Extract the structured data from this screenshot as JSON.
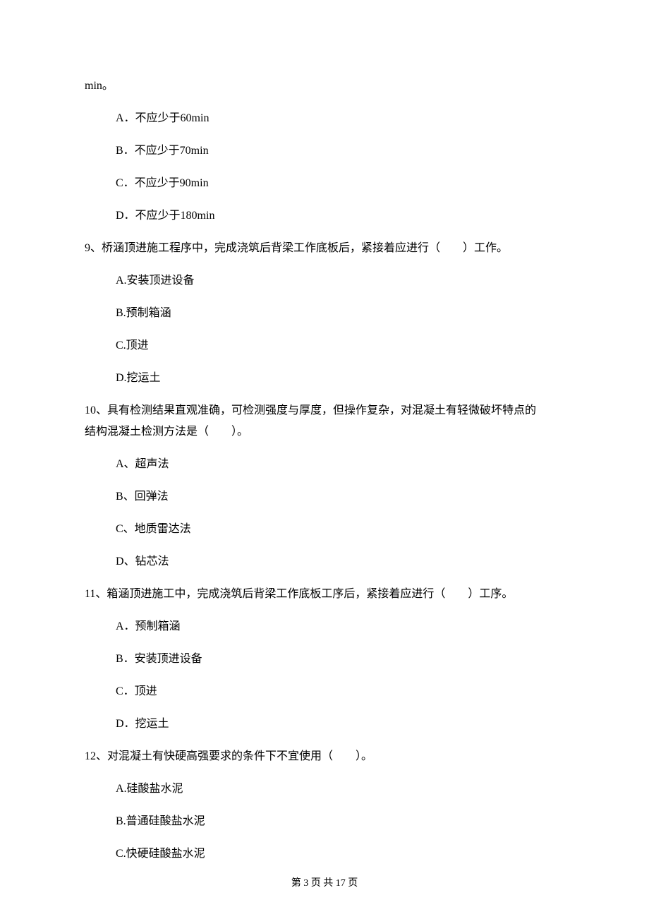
{
  "intro_fragment": "min。",
  "q8_options": {
    "a": "A．不应少于60min",
    "b": "B．不应少于70min",
    "c": "C．不应少于90min",
    "d": "D．不应少于180min"
  },
  "q9": {
    "text": "9、桥涵顶进施工程序中，完成浇筑后背梁工作底板后，紧接着应进行（　　）工作。",
    "a": "A.安装顶进设备",
    "b": "B.预制箱涵",
    "c": "C.顶进",
    "d": "D.挖运土"
  },
  "q10": {
    "text_line1": "10、具有检测结果直观准确，可检测强度与厚度，但操作复杂，对混凝土有轻微破坏特点的",
    "text_line2": "结构混凝土检测方法是（　　）。",
    "a": "A、超声法",
    "b": "B、回弹法",
    "c": "C、地质雷达法",
    "d": "D、钻芯法"
  },
  "q11": {
    "text": "11、箱涵顶进施工中，完成浇筑后背梁工作底板工序后，紧接着应进行（　　）工序。",
    "a": "A．预制箱涵",
    "b": "B．安装顶进设备",
    "c": "C．顶进",
    "d": "D．挖运土"
  },
  "q12": {
    "text": "12、对混凝土有快硬高强要求的条件下不宜使用（　　）。",
    "a": "A.硅酸盐水泥",
    "b": "B.普通硅酸盐水泥",
    "c": "C.快硬硅酸盐水泥"
  },
  "footer": "第 3 页 共 17 页"
}
